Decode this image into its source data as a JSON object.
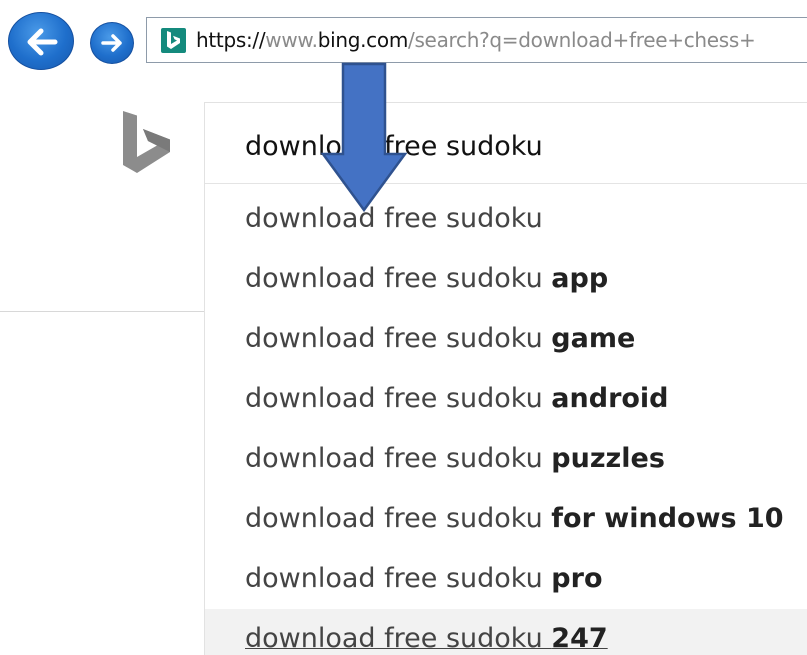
{
  "browser": {
    "back_label": "Back",
    "forward_label": "Forward",
    "address": {
      "scheme": "https://",
      "prefix": "www.",
      "domain": "bing.com",
      "path": "/search?q=download+free+chess+"
    }
  },
  "search": {
    "query": "download free sudoku",
    "suggestions": [
      {
        "base": "download free sudoku",
        "extra": ""
      },
      {
        "base": "download free sudoku ",
        "extra": "app"
      },
      {
        "base": "download free sudoku ",
        "extra": "game"
      },
      {
        "base": "download free sudoku ",
        "extra": "android"
      },
      {
        "base": "download free sudoku ",
        "extra": "puzzles"
      },
      {
        "base": "download free sudoku ",
        "extra": "for windows 10"
      },
      {
        "base": "download free sudoku ",
        "extra": "pro"
      },
      {
        "base": "download free sudoku ",
        "extra": "247"
      }
    ],
    "highlighted_index": 7
  },
  "colors": {
    "nav_blue": "#1f6fcc",
    "favicon_teal": "#148a7d",
    "logo_gray": "#8c8c8c",
    "arrow_fill": "#4472c4",
    "arrow_stroke": "#2f528f"
  },
  "icons": {
    "back": "arrow-left-icon",
    "forward": "arrow-right-icon",
    "favicon": "bing-favicon-icon",
    "logo": "bing-logo-icon",
    "annotation": "down-arrow-annotation"
  }
}
